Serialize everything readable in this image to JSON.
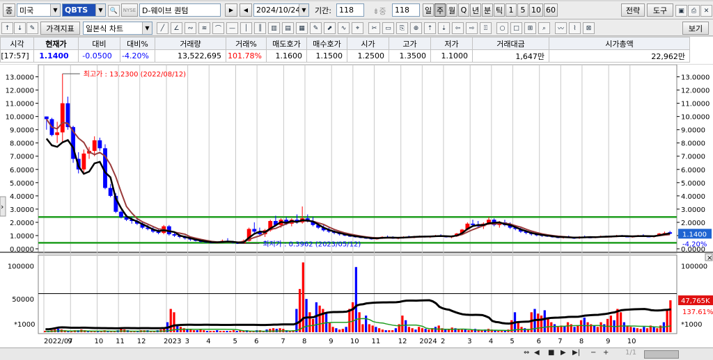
{
  "toolbar1": {
    "type_btn": "종",
    "market": "미국",
    "symbol": "QBTS",
    "exchange_badge": "NYSE",
    "name": "D-웨이브 퀀텀",
    "date": "2024/10/24",
    "period_label": "기간:",
    "period_value": "118",
    "count_value": "118",
    "timeframes": [
      "일",
      "주",
      "월",
      "Q",
      "년",
      "분",
      "틱",
      "1",
      "5",
      "10",
      "60"
    ],
    "selected_timeframe": "주",
    "strategy_btn": "전략",
    "tools_btn": "도구"
  },
  "toolbar2": {
    "indicator_btn": "가격지표",
    "chart_type": "일본식 차트",
    "view_btn": "보기"
  },
  "quote": {
    "headers": [
      "시각",
      "현재가",
      "대비",
      "대비%",
      "거래량",
      "거래%",
      "매도호가",
      "매수호가",
      "시가",
      "고가",
      "저가",
      "거래대금",
      "시가총액"
    ],
    "values": [
      "[17:57]",
      "1.1400",
      "-0.0500",
      "-4.20%",
      "13,522,695",
      "101.78%",
      "1.1600",
      "1.1500",
      "1.2500",
      "1.3500",
      "1.1000",
      "1,647만",
      "22,962만"
    ]
  },
  "chart_data": {
    "type": "candlestick",
    "price_axis": [
      "13.0000",
      "12.0000",
      "11.0000",
      "10.0000",
      "9.0000",
      "8.0000",
      "7.0000",
      "6.0000",
      "5.0000",
      "4.0000",
      "3.0000",
      "2.0000",
      "1.0000",
      "0.0000"
    ],
    "price_range": [
      0,
      13.5
    ],
    "volume_axis": [
      "100000",
      "50000"
    ],
    "volume_unit": "*1000",
    "x_labels": [
      "2022/07",
      "9",
      "10",
      "11",
      "12",
      "2023",
      "3",
      "4",
      "5",
      "6",
      "7",
      "8",
      "9",
      "10",
      "11",
      "12",
      "2024",
      "2",
      "3",
      "4",
      "5",
      "6",
      "7",
      "8",
      "9",
      "10"
    ],
    "high_annotation": "최고가 : 13.2300 (2022/08/12)",
    "low_annotation": "최저가 : 0.3962 (2023/05/12)",
    "current_price_tag": "1.1400",
    "current_change_tag": "-4.20%",
    "volume_tag": "47,765K",
    "volume_pct_tag": "137.61%",
    "support_lines": [
      2.4,
      0.45
    ],
    "volume_ref_line": 58000,
    "up_color": "#ff0000",
    "down_color": "#0000ff",
    "ma_colors": [
      "#9a3b3b",
      "#000000",
      "#1f9d1f"
    ],
    "candles": [
      [
        10.0,
        10.0,
        9.0,
        9.8
      ],
      [
        9.8,
        9.9,
        8.5,
        8.6
      ],
      [
        8.6,
        9.6,
        8.0,
        8.8
      ],
      [
        8.8,
        13.23,
        8.0,
        11.0
      ],
      [
        11.0,
        11.5,
        9.0,
        9.2
      ],
      [
        9.2,
        9.3,
        6.5,
        6.8
      ],
      [
        6.8,
        7.3,
        5.7,
        6.0
      ],
      [
        6.0,
        7.5,
        5.8,
        7.2
      ],
      [
        7.2,
        7.7,
        6.8,
        7.4
      ],
      [
        7.4,
        8.5,
        7.0,
        8.2
      ],
      [
        8.2,
        8.4,
        7.4,
        7.6
      ],
      [
        7.6,
        7.9,
        4.5,
        4.6
      ],
      [
        4.6,
        4.9,
        3.9,
        4.0
      ],
      [
        4.0,
        4.2,
        2.7,
        2.8
      ],
      [
        2.8,
        2.9,
        2.3,
        2.4
      ],
      [
        2.4,
        2.6,
        2.1,
        2.2
      ],
      [
        2.2,
        2.4,
        1.9,
        2.1
      ],
      [
        2.1,
        2.3,
        1.8,
        1.9
      ],
      [
        1.9,
        2.0,
        1.5,
        1.6
      ],
      [
        1.6,
        1.8,
        1.4,
        1.5
      ],
      [
        1.5,
        1.7,
        1.2,
        1.3
      ],
      [
        1.3,
        1.5,
        1.1,
        1.2
      ],
      [
        1.2,
        1.8,
        1.1,
        1.7
      ],
      [
        1.7,
        1.8,
        1.0,
        1.1
      ],
      [
        1.1,
        1.2,
        0.9,
        1.0
      ],
      [
        1.0,
        1.1,
        0.8,
        0.9
      ],
      [
        0.9,
        1.0,
        0.7,
        0.8
      ],
      [
        0.8,
        0.9,
        0.6,
        0.7
      ],
      [
        0.7,
        0.8,
        0.55,
        0.6
      ],
      [
        0.6,
        0.7,
        0.5,
        0.55
      ],
      [
        0.55,
        0.65,
        0.45,
        0.5
      ],
      [
        0.5,
        0.6,
        0.42,
        0.45
      ],
      [
        0.45,
        0.55,
        0.4,
        0.5
      ],
      [
        0.5,
        0.7,
        0.45,
        0.6
      ],
      [
        0.6,
        0.8,
        0.5,
        0.55
      ],
      [
        0.55,
        0.6,
        0.4,
        0.45
      ],
      [
        0.45,
        0.5,
        0.3962,
        0.42
      ],
      [
        0.42,
        0.7,
        0.4,
        0.6
      ],
      [
        0.6,
        1.6,
        0.55,
        1.5
      ],
      [
        1.5,
        2.0,
        1.2,
        1.3
      ],
      [
        1.3,
        1.6,
        1.0,
        1.1
      ],
      [
        1.1,
        1.5,
        0.9,
        1.4
      ],
      [
        1.4,
        2.2,
        1.3,
        2.1
      ],
      [
        2.1,
        2.5,
        1.7,
        1.8
      ],
      [
        1.8,
        2.3,
        1.6,
        2.2
      ],
      [
        2.2,
        2.4,
        1.8,
        1.9
      ],
      [
        1.9,
        2.3,
        1.7,
        2.2
      ],
      [
        2.2,
        2.6,
        1.9,
        2.0
      ],
      [
        2.0,
        3.2,
        1.9,
        2.3
      ],
      [
        2.3,
        2.6,
        2.0,
        2.1
      ],
      [
        2.1,
        2.4,
        1.7,
        1.8
      ],
      [
        1.8,
        2.0,
        1.5,
        1.6
      ],
      [
        1.6,
        1.8,
        1.3,
        1.4
      ],
      [
        1.4,
        1.6,
        1.2,
        1.3
      ],
      [
        1.3,
        1.4,
        1.1,
        1.2
      ],
      [
        1.2,
        1.3,
        1.0,
        1.1
      ],
      [
        1.1,
        1.2,
        0.95,
        1.0
      ],
      [
        1.0,
        1.1,
        0.9,
        0.95
      ],
      [
        0.95,
        1.05,
        0.85,
        0.9
      ],
      [
        0.9,
        1.0,
        0.8,
        0.85
      ],
      [
        0.85,
        0.95,
        0.75,
        0.8
      ],
      [
        0.8,
        0.9,
        0.7,
        0.78
      ],
      [
        0.78,
        0.88,
        0.7,
        0.8
      ],
      [
        0.8,
        0.95,
        0.75,
        0.9
      ],
      [
        0.9,
        1.0,
        0.8,
        0.85
      ],
      [
        0.85,
        0.95,
        0.75,
        0.8
      ],
      [
        0.8,
        0.9,
        0.72,
        0.85
      ],
      [
        0.85,
        0.95,
        0.78,
        0.9
      ],
      [
        0.9,
        1.0,
        0.82,
        0.88
      ],
      [
        0.88,
        0.98,
        0.8,
        0.92
      ],
      [
        0.92,
        1.0,
        0.85,
        0.95
      ],
      [
        0.95,
        1.0,
        0.85,
        0.9
      ],
      [
        0.9,
        1.0,
        0.82,
        0.95
      ],
      [
        0.95,
        1.05,
        0.9,
        1.0
      ],
      [
        1.0,
        1.1,
        0.9,
        0.95
      ],
      [
        0.95,
        1.0,
        0.85,
        0.9
      ],
      [
        0.9,
        1.0,
        0.8,
        0.95
      ],
      [
        0.95,
        1.2,
        0.9,
        1.15
      ],
      [
        1.15,
        1.5,
        1.1,
        1.45
      ],
      [
        1.45,
        2.0,
        1.4,
        1.9
      ],
      [
        1.9,
        2.2,
        1.7,
        1.8
      ],
      [
        1.8,
        2.1,
        1.6,
        1.7
      ],
      [
        1.7,
        2.0,
        1.5,
        1.9
      ],
      [
        1.9,
        2.4,
        1.8,
        2.2
      ],
      [
        2.2,
        2.3,
        1.7,
        1.8
      ],
      [
        1.8,
        2.1,
        1.6,
        2.0
      ],
      [
        2.0,
        2.2,
        1.7,
        1.8
      ],
      [
        1.8,
        2.0,
        1.5,
        1.6
      ],
      [
        1.6,
        1.8,
        1.4,
        1.5
      ],
      [
        1.5,
        1.6,
        1.2,
        1.3
      ],
      [
        1.3,
        1.4,
        1.1,
        1.2
      ],
      [
        1.2,
        1.3,
        1.0,
        1.1
      ],
      [
        1.1,
        1.2,
        0.95,
        1.05
      ],
      [
        1.05,
        1.15,
        0.9,
        1.0
      ],
      [
        1.0,
        1.1,
        0.9,
        0.95
      ],
      [
        0.95,
        1.05,
        0.85,
        0.9
      ],
      [
        0.9,
        1.0,
        0.8,
        0.85
      ],
      [
        0.85,
        0.95,
        0.78,
        0.9
      ],
      [
        0.9,
        1.0,
        0.82,
        0.85
      ],
      [
        0.85,
        0.9,
        0.75,
        0.8
      ],
      [
        0.8,
        0.95,
        0.75,
        0.92
      ],
      [
        0.92,
        1.0,
        0.85,
        0.88
      ],
      [
        0.88,
        0.95,
        0.8,
        0.85
      ],
      [
        0.85,
        0.95,
        0.8,
        0.9
      ],
      [
        0.9,
        1.0,
        0.85,
        0.95
      ],
      [
        0.95,
        1.0,
        0.85,
        0.9
      ],
      [
        0.9,
        1.0,
        0.85,
        0.95
      ],
      [
        0.95,
        1.05,
        0.88,
        1.0
      ],
      [
        1.0,
        1.05,
        0.9,
        0.95
      ],
      [
        0.95,
        1.0,
        0.88,
        0.92
      ],
      [
        0.92,
        1.0,
        0.85,
        0.95
      ],
      [
        0.95,
        1.05,
        0.9,
        1.0
      ],
      [
        1.0,
        1.1,
        0.92,
        0.95
      ],
      [
        0.95,
        1.0,
        0.88,
        0.92
      ],
      [
        0.92,
        1.0,
        0.85,
        0.98
      ],
      [
        0.98,
        1.2,
        0.95,
        1.15
      ],
      [
        1.15,
        1.3,
        1.05,
        1.19
      ],
      [
        1.25,
        1.35,
        1.1,
        1.14
      ]
    ],
    "volumes": [
      2,
      2,
      3,
      4,
      5,
      4,
      3,
      2,
      2,
      3,
      3,
      4,
      3,
      2,
      2,
      2,
      2,
      2,
      3,
      2,
      2,
      2,
      3,
      5,
      4,
      3,
      2,
      2,
      2,
      3,
      3,
      3,
      2,
      2,
      3,
      4,
      6,
      15,
      35,
      30,
      12,
      8,
      6,
      5,
      4,
      3,
      3,
      4,
      3,
      2,
      2,
      2,
      3,
      2,
      2,
      2,
      2,
      3,
      2,
      3,
      2,
      3,
      2,
      2,
      3,
      3,
      2,
      4,
      5,
      6,
      5,
      6,
      5,
      3,
      2,
      3,
      35,
      65,
      105,
      50,
      30,
      20,
      45,
      40,
      35,
      28,
      15,
      8,
      6,
      4,
      5,
      8,
      35,
      45,
      98,
      30,
      12,
      25,
      12,
      10,
      8,
      6,
      4,
      3,
      3,
      3,
      6,
      12,
      25,
      18,
      8,
      6,
      4,
      8,
      6,
      5,
      4,
      6,
      8,
      10,
      6,
      4,
      5,
      7,
      6,
      5,
      4,
      4,
      3,
      4,
      5,
      4,
      3,
      4,
      5,
      4,
      3,
      2,
      3,
      3,
      4,
      18,
      30,
      15,
      8,
      6,
      5,
      30,
      35,
      28,
      25,
      33,
      20,
      15,
      12,
      8,
      10,
      9,
      15,
      12,
      8,
      10,
      18,
      22,
      15,
      12,
      10,
      8,
      15,
      12,
      20,
      25,
      18,
      35,
      30,
      15,
      10,
      8,
      7,
      6,
      5,
      8,
      6,
      10,
      8,
      6,
      10,
      15,
      35,
      48
    ]
  },
  "bottom_bar": {
    "pager": "1/1"
  }
}
